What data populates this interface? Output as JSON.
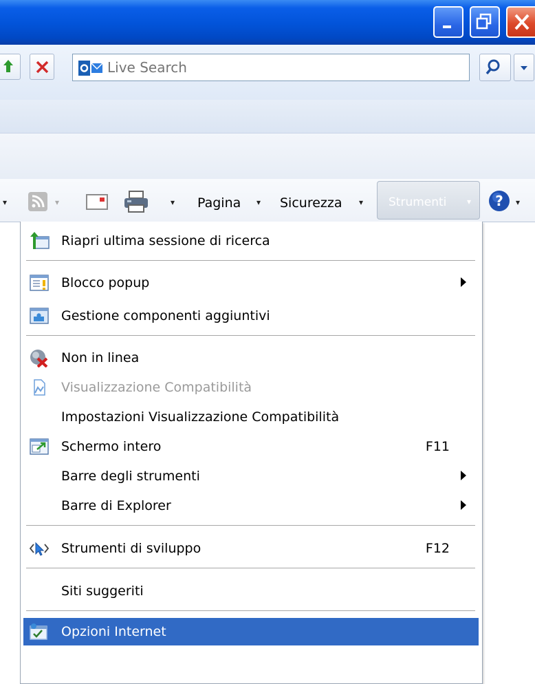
{
  "search": {
    "placeholder": "Live Search",
    "value": ""
  },
  "commandbar": {
    "pagina": "Pagina",
    "sicurezza": "Sicurezza",
    "strumenti": "Strumenti"
  },
  "menu": {
    "items": [
      {
        "label": "Riapri ultima sessione di ricerca",
        "icon": "reopen-session-icon"
      },
      {
        "label": "Blocco popup",
        "icon": "popup-blocker-icon",
        "submenu": true
      },
      {
        "label": "Gestione componenti aggiuntivi",
        "icon": "addons-icon"
      },
      {
        "label": "Non in linea",
        "icon": "offline-icon"
      },
      {
        "label": "Visualizzazione Compatibilità",
        "icon": "compatibility-view-icon",
        "disabled": true
      },
      {
        "label": "Impostazioni Visualizzazione Compatibilità"
      },
      {
        "label": "Schermo intero",
        "icon": "fullscreen-icon",
        "shortcut": "F11"
      },
      {
        "label": "Barre degli strumenti",
        "submenu": true
      },
      {
        "label": "Barre di Explorer",
        "submenu": true
      },
      {
        "label": "Strumenti di sviluppo",
        "icon": "developer-tools-icon",
        "shortcut": "F12"
      },
      {
        "label": "Siti suggeriti"
      },
      {
        "label": "Opzioni Internet",
        "icon": "internet-options-icon",
        "selected": true
      }
    ]
  },
  "colors": {
    "titlebar": "#0253d8",
    "menu_highlight": "#316ac5"
  }
}
